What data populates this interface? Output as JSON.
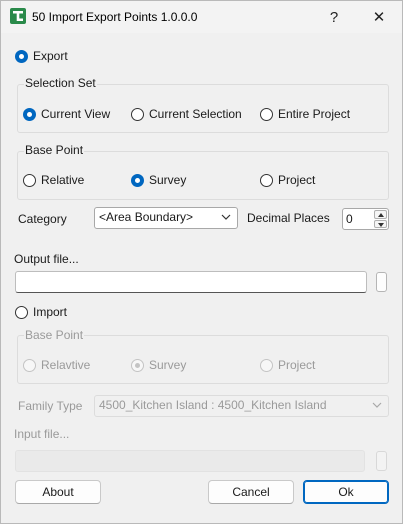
{
  "window": {
    "title": "50 Import Export Points 1.0.0.0",
    "help_label": "?",
    "close_label": "✕"
  },
  "colors": {
    "accent": "#0067c0",
    "app_icon": "#2a8a4a"
  },
  "export": {
    "radio_label": "Export",
    "checked": true,
    "selection_set": {
      "title": "Selection Set",
      "options": [
        {
          "label": "Current View",
          "checked": true
        },
        {
          "label": "Current Selection",
          "checked": false
        },
        {
          "label": "Entire Project",
          "checked": false
        }
      ]
    },
    "base_point": {
      "title": "Base Point",
      "options": [
        {
          "label": "Relative",
          "checked": false
        },
        {
          "label": "Survey",
          "checked": true
        },
        {
          "label": "Project",
          "checked": false
        }
      ]
    },
    "category_label": "Category",
    "category_value": "<Area Boundary>",
    "decimal_places_label": "Decimal Places",
    "decimal_places_value": "0",
    "output_file_label": "Output file...",
    "output_file_value": ""
  },
  "import": {
    "radio_label": "Import",
    "checked": false,
    "base_point": {
      "title": "Base Point",
      "options": [
        {
          "label": "Relavtive",
          "checked": false
        },
        {
          "label": "Survey",
          "checked": true
        },
        {
          "label": "Project",
          "checked": false
        }
      ]
    },
    "family_type_label": "Family Type",
    "family_type_value": "4500_Kitchen Island : 4500_Kitchen Island",
    "input_file_label": "Input file...",
    "input_file_value": ""
  },
  "buttons": {
    "about": "About",
    "cancel": "Cancel",
    "ok": "Ok"
  }
}
